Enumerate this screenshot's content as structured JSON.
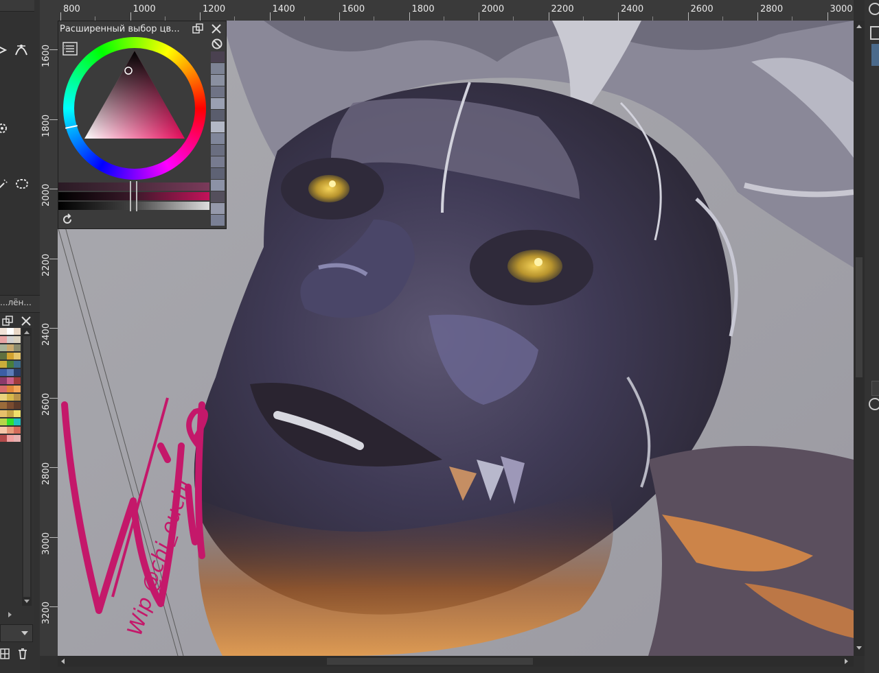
{
  "docker": {
    "title": "Расширенный выбор цв...",
    "selected_color": "#c4125a",
    "recent_colors": [
      "#4a4150",
      "#7d8394",
      "#8a90a0",
      "#6f7385",
      "#9aa0b2",
      "#5a5d6d",
      "#b3b8c6",
      "#80869a",
      "#6a6e80",
      "#777b8f",
      "#5e6274",
      "#8c92a6",
      "#544f5c",
      "#9599ab",
      "#7a8095"
    ]
  },
  "left_toolbar": {
    "palette_title": "...лён...",
    "palette_colors": [
      "#f1e3d8",
      "#ffffff",
      "#e8d7c6",
      "#e7a4a4",
      "#cfcfcf",
      "#d9d1c0",
      "#a8b39a",
      "#c9aa70",
      "#8c8c6f",
      "#5f6f3f",
      "#d2a22f",
      "#e5c56b",
      "#c9ad3a",
      "#4a7d3a",
      "#3e6d8b",
      "#3c5ea5",
      "#5c7db8",
      "#2b3f6b",
      "#8b3a6a",
      "#c85f8a",
      "#a13c3c",
      "#d66b6b",
      "#e0863a",
      "#f2a65a",
      "#e9d27d",
      "#d6b84a",
      "#b8934a",
      "#9b6b3a",
      "#7a4b2f",
      "#5b3a2a",
      "#e6c06a",
      "#c7a546",
      "#f0e06a",
      "#b6d44a",
      "#2fe02f",
      "#1fbfbf",
      "#f5c7a8",
      "#e59a7a",
      "#d46b5a",
      "#b24a4a",
      "#f2a0a0",
      "#e8b0b0"
    ]
  },
  "ruler": {
    "x_labels": [
      "800",
      "1000",
      "1200",
      "1400",
      "1600",
      "1800",
      "2000",
      "2200",
      "2400",
      "2600",
      "2800",
      "3000"
    ],
    "y_labels": [
      "1600",
      "1800",
      "2000",
      "2200",
      "2400",
      "2600",
      "2800",
      "3000",
      "3200"
    ]
  },
  "canvas": {
    "signature_text": "Wip @chi_ouchi",
    "signature_color": "#c4186a"
  }
}
